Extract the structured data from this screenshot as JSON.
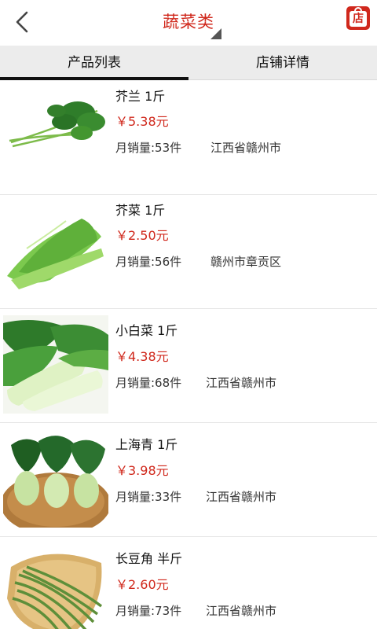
{
  "header": {
    "title": "蔬菜类",
    "shop_icon_label": "店"
  },
  "tabs": [
    {
      "label": "产品列表",
      "active": true
    },
    {
      "label": "店铺详情",
      "active": false
    }
  ],
  "products": [
    {
      "name": "芥兰 1斤",
      "price": "￥5.38元",
      "sales": "月销量:53件",
      "location": "江西省赣州市",
      "image": "kale-image"
    },
    {
      "name": "芥菜 1斤",
      "price": "￥2.50元",
      "sales": "月销量:56件",
      "location": "赣州市章贡区",
      "image": "mustard-greens-image"
    },
    {
      "name": "小白菜 1斤",
      "price": "￥4.38元",
      "sales": "月销量:68件",
      "location": "江西省赣州市",
      "image": "bok-choy-image"
    },
    {
      "name": "上海青 1斤",
      "price": "￥3.98元",
      "sales": "月销量:33件",
      "location": "江西省赣州市",
      "image": "shanghai-greens-image"
    },
    {
      "name": "长豆角 半斤",
      "price": "￥2.60元",
      "sales": "月销量:73件",
      "location": "江西省赣州市",
      "image": "long-beans-image"
    }
  ],
  "colors": {
    "accent": "#d0281c",
    "tab_bar": "#ececec"
  }
}
